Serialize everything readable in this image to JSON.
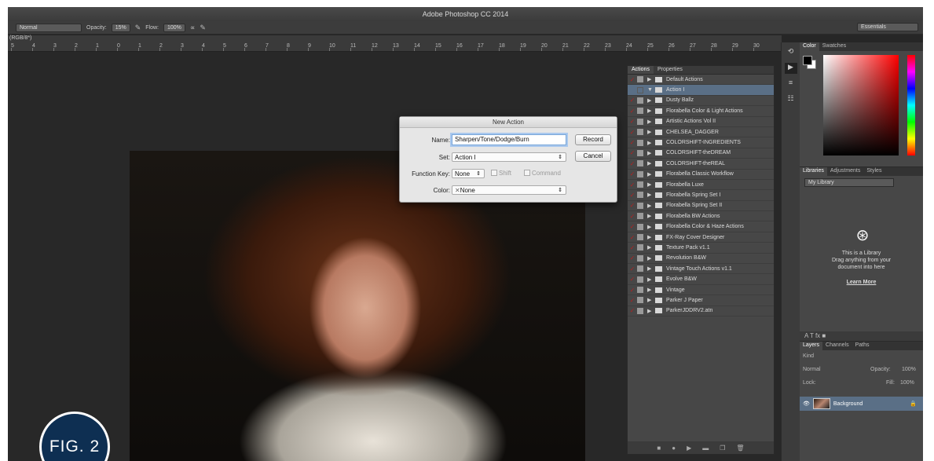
{
  "app": {
    "title": "Adobe Photoshop CC 2014"
  },
  "options_bar": {
    "mode": "Normal",
    "opacity_label": "Opacity:",
    "opacity_value": "15%",
    "flow_label": "Flow:",
    "flow_value": "100%",
    "workspace": "Essentials"
  },
  "document": {
    "tab_label": "(RGB/8*)"
  },
  "ruler": {
    "ticks": [
      "5",
      "4",
      "3",
      "2",
      "1",
      "0",
      "1",
      "2",
      "3",
      "4",
      "5",
      "6",
      "7",
      "8",
      "9",
      "10",
      "11",
      "12",
      "13",
      "14",
      "15",
      "16",
      "17",
      "18",
      "19",
      "20",
      "21",
      "22",
      "23",
      "24",
      "25",
      "26",
      "27",
      "28",
      "29",
      "30"
    ]
  },
  "figure_badge": "FIG. 2",
  "dialog": {
    "title": "New Action",
    "name_label": "Name:",
    "name_value": "Sharpen/Tone/Dodge/Burn",
    "set_label": "Set:",
    "set_value": "Action I",
    "function_key_label": "Function Key:",
    "function_key_value": "None",
    "shift_label": "Shift",
    "command_label": "Command",
    "color_label": "Color:",
    "color_value": "None",
    "record_label": "Record",
    "cancel_label": "Cancel"
  },
  "actions_panel": {
    "tabs": [
      "Actions",
      "Properties"
    ],
    "items": [
      {
        "label": "Default Actions",
        "checked": true,
        "selected": false,
        "open": false
      },
      {
        "label": "Action I",
        "checked": false,
        "selected": true,
        "open": true
      },
      {
        "label": "Dusty Ballz",
        "checked": true,
        "selected": false,
        "open": false
      },
      {
        "label": "Florabella Color & Light Actions",
        "checked": true,
        "selected": false,
        "open": false
      },
      {
        "label": "Artistic Actions Vol II",
        "checked": true,
        "selected": false,
        "open": false
      },
      {
        "label": "CHELSEA_DAGGER",
        "checked": true,
        "selected": false,
        "open": false
      },
      {
        "label": "COLORSHIFT-INGREDIENTS",
        "checked": true,
        "selected": false,
        "open": false
      },
      {
        "label": "COLORSHIFT-theDREAM",
        "checked": true,
        "selected": false,
        "open": false
      },
      {
        "label": "COLORSHIFT-theREAL",
        "checked": true,
        "selected": false,
        "open": false
      },
      {
        "label": "Florabella Classic Workflow",
        "checked": true,
        "selected": false,
        "open": false
      },
      {
        "label": "Florabella Luxe",
        "checked": true,
        "selected": false,
        "open": false
      },
      {
        "label": "Florabella Spring Set I",
        "checked": true,
        "selected": false,
        "open": false
      },
      {
        "label": "Florabella Spring Set II",
        "checked": true,
        "selected": false,
        "open": false
      },
      {
        "label": "Florabella BW Actions",
        "checked": true,
        "selected": false,
        "open": false
      },
      {
        "label": "Florabella Color & Haze Actions",
        "checked": true,
        "selected": false,
        "open": false
      },
      {
        "label": "FX-Ray Cover Designer",
        "checked": true,
        "selected": false,
        "open": false
      },
      {
        "label": "Texture Pack v1.1",
        "checked": true,
        "selected": false,
        "open": false
      },
      {
        "label": "Revolution B&W",
        "checked": true,
        "selected": false,
        "open": false
      },
      {
        "label": "Vintage Touch Actions v1.1",
        "checked": true,
        "selected": false,
        "open": false
      },
      {
        "label": "Evolve B&W",
        "checked": true,
        "selected": false,
        "open": false
      },
      {
        "label": "Vintage",
        "checked": true,
        "selected": false,
        "open": false
      },
      {
        "label": "Parker J Paper",
        "checked": true,
        "selected": false,
        "open": false
      },
      {
        "label": "ParkerJDDRV2.atn",
        "checked": true,
        "selected": false,
        "open": false
      }
    ]
  },
  "color_panel": {
    "tabs": [
      "Color",
      "Swatches"
    ],
    "foreground": "#000000",
    "background": "#ffffff",
    "hue_accent": "#ff0000"
  },
  "libraries_panel": {
    "tabs": [
      "Libraries",
      "Adjustments",
      "Styles"
    ],
    "library_select": "My Library",
    "empty_line1": "This is a Library",
    "empty_line2": "Drag anything from your",
    "empty_line3": "document into here",
    "learn_more": "Learn More"
  },
  "layers_panel": {
    "tabs": [
      "Layers",
      "Channels",
      "Paths"
    ],
    "kind_filter": "Kind",
    "blend_mode": "Normal",
    "opacity_label": "Opacity:",
    "opacity_value": "100%",
    "lock_label": "Lock:",
    "fill_label": "Fill:",
    "fill_value": "100%",
    "layer_name": "Background"
  }
}
